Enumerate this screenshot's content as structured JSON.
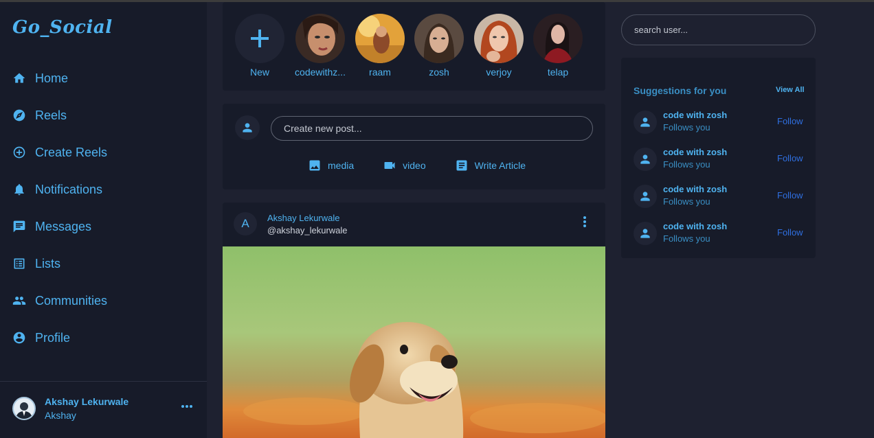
{
  "app": {
    "logo": "Go_Social"
  },
  "sidebar": {
    "items": [
      {
        "label": "Home",
        "icon": "home-icon"
      },
      {
        "label": "Reels",
        "icon": "compass-icon"
      },
      {
        "label": "Create Reels",
        "icon": "add-circle-icon"
      },
      {
        "label": "Notifications",
        "icon": "bell-icon"
      },
      {
        "label": "Messages",
        "icon": "message-icon"
      },
      {
        "label": "Lists",
        "icon": "list-icon"
      },
      {
        "label": "Communities",
        "icon": "people-icon"
      },
      {
        "label": "Profile",
        "icon": "account-circle-icon"
      }
    ],
    "profile": {
      "name": "Akshay Lekurwale",
      "handle": "Akshay"
    }
  },
  "stories": [
    {
      "label": "New",
      "icon": "plus-icon"
    },
    {
      "label": "codewithz..."
    },
    {
      "label": "raam"
    },
    {
      "label": "zosh"
    },
    {
      "label": "verjoy"
    },
    {
      "label": "telap"
    }
  ],
  "create_post": {
    "placeholder": "Create new post...",
    "actions": [
      {
        "label": "media",
        "icon": "image-icon"
      },
      {
        "label": "video",
        "icon": "videocam-icon"
      },
      {
        "label": "Write Article",
        "icon": "article-icon"
      }
    ]
  },
  "post": {
    "avatar_letter": "A",
    "author": "Akshay Lekurwale",
    "handle": "@akshay_lekurwale"
  },
  "search": {
    "placeholder": "search user..."
  },
  "suggestions": {
    "title": "Suggestions for you",
    "view_all": "View All",
    "items": [
      {
        "name": "code with zosh",
        "subtitle": "Follows you",
        "action": "Follow"
      },
      {
        "name": "code with zosh",
        "subtitle": "Follows you",
        "action": "Follow"
      },
      {
        "name": "code with zosh",
        "subtitle": "Follows you",
        "action": "Follow"
      },
      {
        "name": "code with zosh",
        "subtitle": "Follows you",
        "action": "Follow"
      }
    ]
  },
  "colors": {
    "background": "#1e2130",
    "panel": "#171b29",
    "accent": "#4fb3f0",
    "follow": "#2f6fe0"
  }
}
